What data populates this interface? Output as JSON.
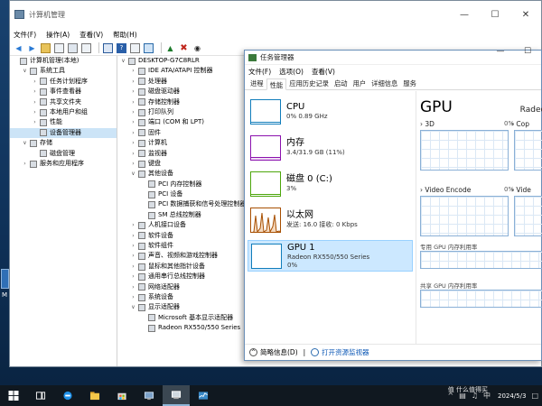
{
  "computer_management": {
    "title": "计算机管理",
    "menu": [
      "文件(F)",
      "操作(A)",
      "查看(V)",
      "帮助(H)"
    ],
    "left_tree": [
      {
        "label": "计算机管理(本地)",
        "level": 0,
        "expander": "",
        "selected": false
      },
      {
        "label": "系统工具",
        "level": 1,
        "expander": "v",
        "selected": false
      },
      {
        "label": "任务计划程序",
        "level": 2,
        "expander": ">",
        "selected": false
      },
      {
        "label": "事件查看器",
        "level": 2,
        "expander": ">",
        "selected": false
      },
      {
        "label": "共享文件夹",
        "level": 2,
        "expander": ">",
        "selected": false
      },
      {
        "label": "本地用户和组",
        "level": 2,
        "expander": ">",
        "selected": false
      },
      {
        "label": "性能",
        "level": 2,
        "expander": ">",
        "selected": false
      },
      {
        "label": "设备管理器",
        "level": 2,
        "expander": "",
        "selected": true
      },
      {
        "label": "存储",
        "level": 1,
        "expander": "v",
        "selected": false
      },
      {
        "label": "磁盘管理",
        "level": 2,
        "expander": "",
        "selected": false
      },
      {
        "label": "服务和应用程序",
        "level": 1,
        "expander": ">",
        "selected": false
      }
    ],
    "device_tree": [
      {
        "label": "DESKTOP-G7C8RLR",
        "level": 0,
        "expander": "v"
      },
      {
        "label": "IDE ATA/ATAPI 控制器",
        "level": 1,
        "expander": ">"
      },
      {
        "label": "处理器",
        "level": 1,
        "expander": ">"
      },
      {
        "label": "磁盘驱动器",
        "level": 1,
        "expander": ">"
      },
      {
        "label": "存储控制器",
        "level": 1,
        "expander": ">"
      },
      {
        "label": "打印队列",
        "level": 1,
        "expander": ">"
      },
      {
        "label": "端口 (COM 和 LPT)",
        "level": 1,
        "expander": ">"
      },
      {
        "label": "固件",
        "level": 1,
        "expander": ">"
      },
      {
        "label": "计算机",
        "level": 1,
        "expander": ">"
      },
      {
        "label": "监视器",
        "level": 1,
        "expander": ">"
      },
      {
        "label": "键盘",
        "level": 1,
        "expander": ">"
      },
      {
        "label": "其他设备",
        "level": 1,
        "expander": "v"
      },
      {
        "label": "PCI 内存控制器",
        "level": 2,
        "expander": ""
      },
      {
        "label": "PCI 设备",
        "level": 2,
        "expander": ""
      },
      {
        "label": "PCI 数据捕获和信号处理控制器",
        "level": 2,
        "expander": ""
      },
      {
        "label": "SM 总线控制器",
        "level": 2,
        "expander": ""
      },
      {
        "label": "人机接口设备",
        "level": 1,
        "expander": ">"
      },
      {
        "label": "软件设备",
        "level": 1,
        "expander": ">"
      },
      {
        "label": "软件组件",
        "level": 1,
        "expander": ">"
      },
      {
        "label": "声音、视频和游戏控制器",
        "level": 1,
        "expander": ">"
      },
      {
        "label": "鼠标和其他指针设备",
        "level": 1,
        "expander": ">"
      },
      {
        "label": "通用串行总线控制器",
        "level": 1,
        "expander": ">"
      },
      {
        "label": "网络适配器",
        "level": 1,
        "expander": ">"
      },
      {
        "label": "系统设备",
        "level": 1,
        "expander": ">"
      },
      {
        "label": "显示适配器",
        "level": 1,
        "expander": "v"
      },
      {
        "label": "Microsoft 基本显示适配器",
        "level": 2,
        "expander": ""
      },
      {
        "label": "Radeon RX550/550 Series",
        "level": 2,
        "expander": ""
      }
    ]
  },
  "task_manager": {
    "title": "任务管理器",
    "menu": [
      "文件(F)",
      "选项(O)",
      "查看(V)"
    ],
    "tabs": [
      "进程",
      "性能",
      "应用历史记录",
      "启动",
      "用户",
      "详细信息",
      "服务"
    ],
    "active_tab": 1,
    "resources": [
      {
        "name": "CPU",
        "sub1": "0% 0.89 GHz",
        "sub2": "",
        "color": "#117dbb",
        "selected": false
      },
      {
        "name": "内存",
        "sub1": "3.4/31.9 GB (11%)",
        "sub2": "",
        "color": "#8b12ae",
        "selected": false
      },
      {
        "name": "磁盘 0 (C:)",
        "sub1": "3%",
        "sub2": "",
        "color": "#4da60c",
        "selected": false
      },
      {
        "name": "以太网",
        "sub1": "发送: 16.0  接收: 0 Kbps",
        "sub2": "",
        "color": "#a74f01",
        "selected": false
      },
      {
        "name": "GPU 1",
        "sub1": "Radeon RX550/550 Series",
        "sub2": "0%",
        "color": "#117dbb",
        "selected": true
      }
    ],
    "detail": {
      "title": "GPU",
      "model": "Radeo",
      "graphs": [
        {
          "label": "3D",
          "pct": "0%"
        },
        {
          "label": "Cop",
          "pct": "0%"
        },
        {
          "label": "Video Encode",
          "pct": "0%"
        },
        {
          "label": "Vide",
          "pct": "0%"
        }
      ],
      "dedicated_label": "专用 GPU 内存利用率",
      "shared_label": "共享 GPU 内存利用率"
    },
    "footer": {
      "fewer": "简略信息(D)",
      "link": "打开资源监视器"
    }
  },
  "desktop": {
    "icon_label": "M"
  },
  "taskbar": {
    "tray_chevron": "^",
    "tray_lang": "中",
    "date": "2024/5/3",
    "watermark": "值 什么值得买"
  }
}
